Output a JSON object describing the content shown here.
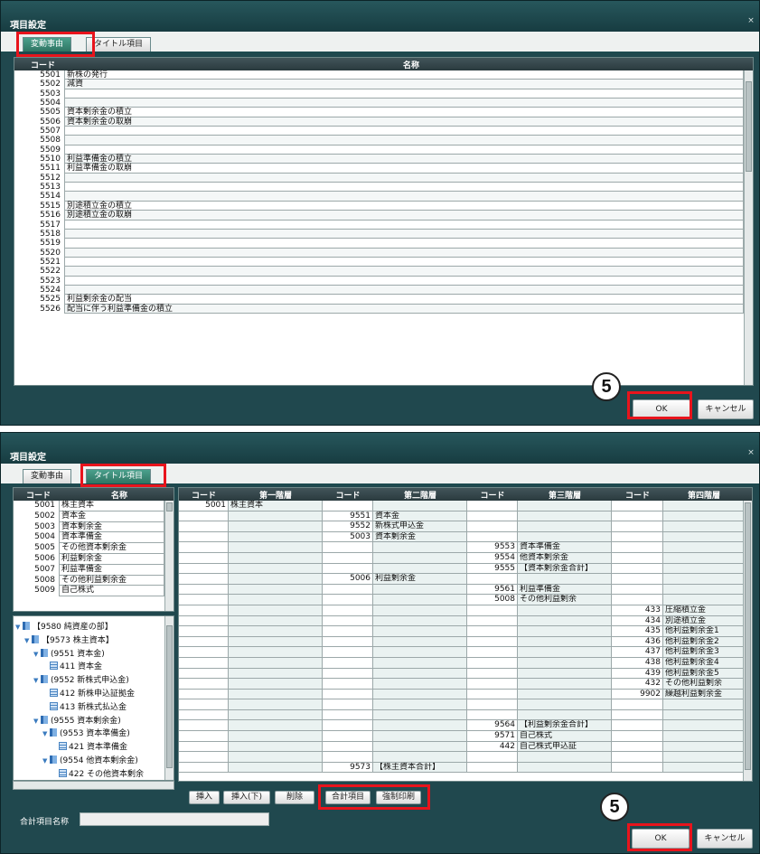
{
  "window_title": "項目設定",
  "close_glyph": "×",
  "tabs": [
    "変動事由",
    "タイトル項目"
  ],
  "marker_number": "5",
  "ok_label": "OK",
  "cancel_label": "キャンセル",
  "top": {
    "headers": {
      "code": "コード",
      "name": "名称"
    },
    "rows": [
      {
        "code": "5501",
        "name": "新株の発行"
      },
      {
        "code": "5502",
        "name": "減資"
      },
      {
        "code": "5503",
        "name": ""
      },
      {
        "code": "5504",
        "name": ""
      },
      {
        "code": "5505",
        "name": "資本剰余金の積立"
      },
      {
        "code": "5506",
        "name": "資本剰余金の取崩"
      },
      {
        "code": "5507",
        "name": ""
      },
      {
        "code": "5508",
        "name": ""
      },
      {
        "code": "5509",
        "name": ""
      },
      {
        "code": "5510",
        "name": "利益準備金の積立"
      },
      {
        "code": "5511",
        "name": "利益準備金の取崩"
      },
      {
        "code": "5512",
        "name": ""
      },
      {
        "code": "5513",
        "name": ""
      },
      {
        "code": "5514",
        "name": ""
      },
      {
        "code": "5515",
        "name": "別途積立金の積立"
      },
      {
        "code": "5516",
        "name": "別途積立金の取崩"
      },
      {
        "code": "5517",
        "name": ""
      },
      {
        "code": "5518",
        "name": ""
      },
      {
        "code": "5519",
        "name": ""
      },
      {
        "code": "5520",
        "name": ""
      },
      {
        "code": "5521",
        "name": ""
      },
      {
        "code": "5522",
        "name": ""
      },
      {
        "code": "5523",
        "name": ""
      },
      {
        "code": "5524",
        "name": ""
      },
      {
        "code": "5525",
        "name": "利益剰余金の配当"
      },
      {
        "code": "5526",
        "name": "配当に伴う利益準備金の積立"
      }
    ]
  },
  "bottom": {
    "left_headers": {
      "code": "コード",
      "name": "名称"
    },
    "left_rows": [
      {
        "code": "5001",
        "name": "株主資本"
      },
      {
        "code": "5002",
        "name": "資本金"
      },
      {
        "code": "5003",
        "name": "資本剰余金"
      },
      {
        "code": "5004",
        "name": "資本準備金"
      },
      {
        "code": "5005",
        "name": "その他資本剰余金"
      },
      {
        "code": "5006",
        "name": "利益剰余金"
      },
      {
        "code": "5007",
        "name": "利益準備金"
      },
      {
        "code": "5008",
        "name": "その他利益剰余金"
      },
      {
        "code": "5009",
        "name": "自己株式"
      }
    ],
    "tree": [
      {
        "indent": 0,
        "type": "folder",
        "label": "【9580 純資産の部】"
      },
      {
        "indent": 1,
        "type": "folder",
        "label": "【9573 株主資本】"
      },
      {
        "indent": 2,
        "type": "folder",
        "label": "(9551 資本金)"
      },
      {
        "indent": 3,
        "type": "doc",
        "label": "411 資本金"
      },
      {
        "indent": 2,
        "type": "folder",
        "label": "(9552 新株式申込金)"
      },
      {
        "indent": 3,
        "type": "doc",
        "label": "412 新株申込証拠金"
      },
      {
        "indent": 3,
        "type": "doc",
        "label": "413 新株式払込金"
      },
      {
        "indent": 2,
        "type": "folder",
        "label": "(9555 資本剰余金)"
      },
      {
        "indent": 3,
        "type": "folder",
        "label": "(9553 資本準備金)"
      },
      {
        "indent": 4,
        "type": "doc",
        "label": "421 資本準備金"
      },
      {
        "indent": 3,
        "type": "folder",
        "label": "(9554 他資本剰余金)"
      },
      {
        "indent": 4,
        "type": "doc",
        "label": "422 その他資本剰余"
      }
    ],
    "grid_headers": [
      "コード",
      "第一階層",
      "コード",
      "第二階層",
      "コード",
      "第三階層",
      "コード",
      "第四階層"
    ],
    "grid_rows": [
      [
        "5001",
        "株主資本",
        "",
        "",
        "",
        "",
        "",
        ""
      ],
      [
        "",
        "",
        "9551",
        "資本金",
        "",
        "",
        "",
        ""
      ],
      [
        "",
        "",
        "9552",
        "新株式申込金",
        "",
        "",
        "",
        ""
      ],
      [
        "",
        "",
        "5003",
        "資本剰余金",
        "",
        "",
        "",
        ""
      ],
      [
        "",
        "",
        "",
        "",
        "9553",
        "資本準備金",
        "",
        ""
      ],
      [
        "",
        "",
        "",
        "",
        "9554",
        "他資本剰余金",
        "",
        ""
      ],
      [
        "",
        "",
        "",
        "",
        "9555",
        "【資本剰余金合計】",
        "",
        ""
      ],
      [
        "",
        "",
        "5006",
        "利益剰余金",
        "",
        "",
        "",
        ""
      ],
      [
        "",
        "",
        "",
        "",
        "9561",
        "利益準備金",
        "",
        ""
      ],
      [
        "",
        "",
        "",
        "",
        "5008",
        "その他利益剰余",
        "",
        ""
      ],
      [
        "",
        "",
        "",
        "",
        "",
        "",
        "433",
        "圧縮積立金"
      ],
      [
        "",
        "",
        "",
        "",
        "",
        "",
        "434",
        "別途積立金"
      ],
      [
        "",
        "",
        "",
        "",
        "",
        "",
        "435",
        "他利益剰余金1"
      ],
      [
        "",
        "",
        "",
        "",
        "",
        "",
        "436",
        "他利益剰余金2"
      ],
      [
        "",
        "",
        "",
        "",
        "",
        "",
        "437",
        "他利益剰余金3"
      ],
      [
        "",
        "",
        "",
        "",
        "",
        "",
        "438",
        "他利益剰余金4"
      ],
      [
        "",
        "",
        "",
        "",
        "",
        "",
        "439",
        "他利益剰余金5"
      ],
      [
        "",
        "",
        "",
        "",
        "",
        "",
        "432",
        "その他利益剰余"
      ],
      [
        "",
        "",
        "",
        "",
        "",
        "",
        "9902",
        "繰越利益剰余金"
      ],
      [
        "",
        "",
        "",
        "",
        "",
        "",
        "",
        ""
      ],
      [
        "",
        "",
        "",
        "",
        "",
        "",
        "",
        ""
      ],
      [
        "",
        "",
        "",
        "",
        "9564",
        "【利益剰余金合計】",
        "",
        ""
      ],
      [
        "",
        "",
        "",
        "",
        "9571",
        "自己株式",
        "",
        ""
      ],
      [
        "",
        "",
        "",
        "",
        "442",
        "自己株式申込証",
        "",
        ""
      ],
      [
        "",
        "",
        "",
        "",
        "",
        "",
        "",
        ""
      ],
      [
        "",
        "",
        "9573",
        "【株主資本合計】",
        "",
        "",
        "",
        ""
      ]
    ],
    "buttons": [
      "挿入",
      "挿入(下)",
      "削除",
      "合計項目",
      "強制印刷"
    ],
    "footer_label": "合計項目名称",
    "footer_value": ""
  }
}
